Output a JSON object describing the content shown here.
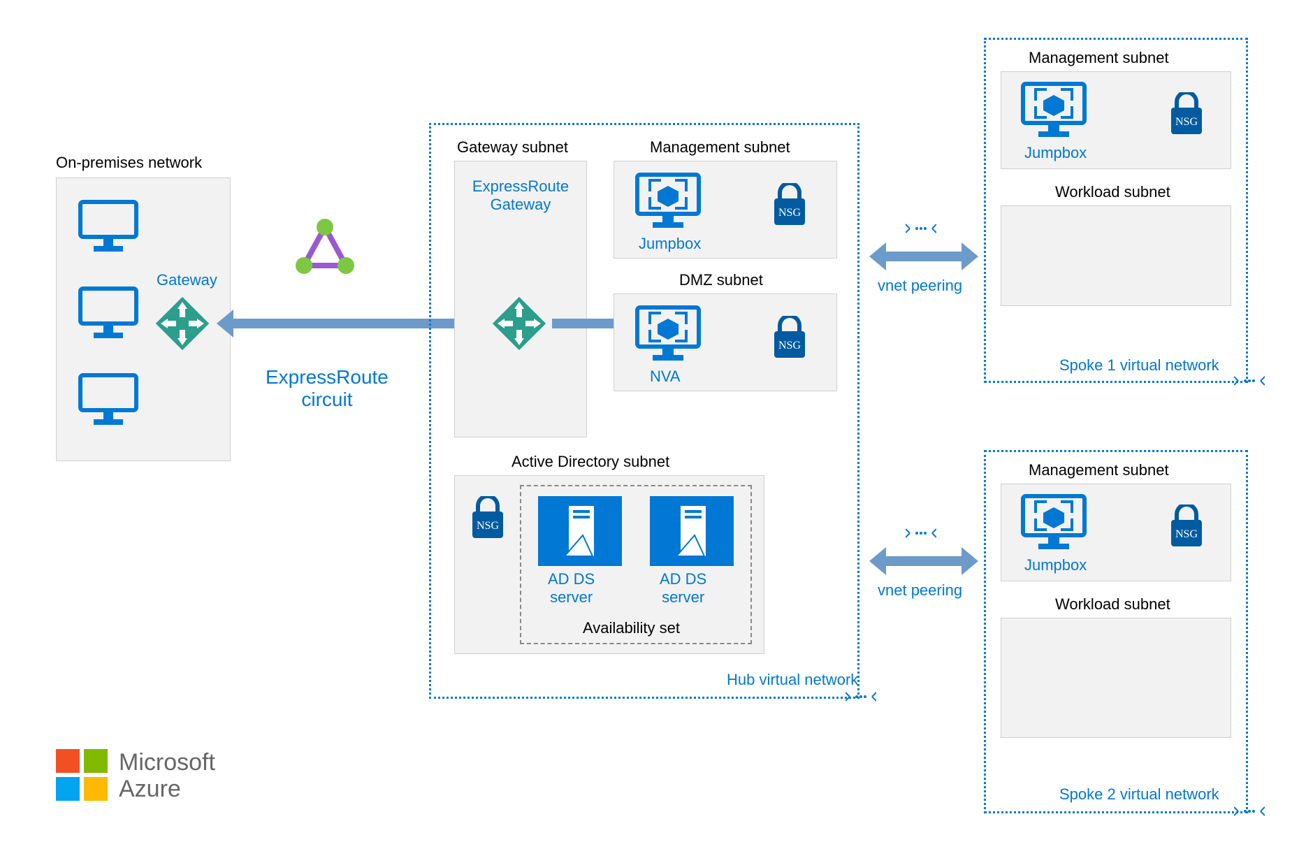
{
  "labels": {
    "onprem_title": "On-premises network",
    "gateway": "Gateway",
    "expressroute_circuit": "ExpressRoute\ncircuit",
    "gateway_subnet": "Gateway subnet",
    "expressroute_gateway": "ExpressRoute\nGateway",
    "management_subnet": "Management subnet",
    "jumpbox": "Jumpbox",
    "nsg": "NSG",
    "dmz_subnet": "DMZ subnet",
    "nva": "NVA",
    "ad_subnet": "Active Directory subnet",
    "ad_ds_server": "AD DS\nserver",
    "availability_set": "Availability set",
    "hub_vnet": "Hub virtual network",
    "vnet_peering": "vnet peering",
    "workload_subnet": "Workload subnet",
    "spoke1": "Spoke 1 virtual network",
    "spoke2": "Spoke 2 virtual network",
    "ms_azure_1": "Microsoft",
    "ms_azure_2": "Azure"
  },
  "colors": {
    "azure_blue": "#0078d4",
    "arrow_blue": "#6c9bc9",
    "box_fill": "#f2f2f2",
    "dark_blue": "#005ba1",
    "teal": "#2b9e8c"
  }
}
